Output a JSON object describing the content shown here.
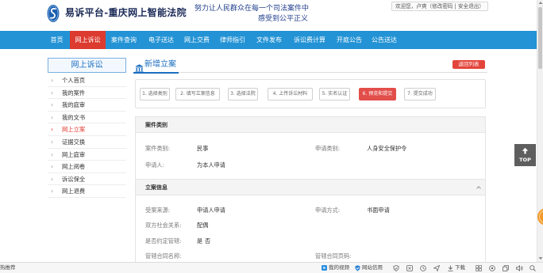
{
  "header": {
    "logo_icon": "court-emblem-icon",
    "site_title": "易诉平台-重庆网上智能法院",
    "slogan_line1": "努力让人民群众在每一个司法案件中",
    "slogan_line2": "感受到公平正义",
    "welcome": "欢迎您，卢爽（",
    "change_password": "修改密码",
    "separator": " | ",
    "logout": "安全退出",
    "welcome_end": "）"
  },
  "nav": {
    "items": [
      {
        "label": "首页",
        "active": false
      },
      {
        "label": "网上诉讼",
        "active": true
      },
      {
        "label": "案件查询",
        "active": false
      },
      {
        "label": "电子送达",
        "active": false
      },
      {
        "label": "网上交费",
        "active": false
      },
      {
        "label": "律师指引",
        "active": false
      },
      {
        "label": "文件发布",
        "active": false
      },
      {
        "label": "诉讼费计算",
        "active": false
      },
      {
        "label": "开庭公告",
        "active": false
      },
      {
        "label": "公告送达",
        "active": false
      }
    ]
  },
  "sidebar": {
    "title": "网上诉讼",
    "item_icon": "chevron-right-icon",
    "items": [
      {
        "label": "个人首页",
        "active": false
      },
      {
        "label": "我的案件",
        "active": false
      },
      {
        "label": "我的庭审",
        "active": false
      },
      {
        "label": "我的文书",
        "active": false
      },
      {
        "label": "网上立案",
        "active": true
      },
      {
        "label": "证据交换",
        "active": false
      },
      {
        "label": "网上庭审",
        "active": false
      },
      {
        "label": "网上阅卷",
        "active": false
      },
      {
        "label": "诉讼保全",
        "active": false
      },
      {
        "label": "网上退费",
        "active": false
      }
    ]
  },
  "main": {
    "title_icon": "courthouse-icon",
    "page_title": "新增立案",
    "back_button": "返回列表",
    "steps": [
      {
        "label": "1. 选择类别",
        "active": false
      },
      {
        "label": "2. 填写立案信息",
        "active": false
      },
      {
        "label": "3. 选择法院",
        "active": false
      },
      {
        "label": "4. 上传诉讼材料",
        "active": false
      },
      {
        "label": "5. 实名认证",
        "active": false
      },
      {
        "label": "6. 预览和提交",
        "active": true
      },
      {
        "label": "7. 提交成功",
        "active": false
      }
    ],
    "case_category": {
      "title": "案件类别",
      "rows": [
        {
          "label": "案件类别:",
          "value": "民事",
          "label2": "申请类别:",
          "value2": "人身安全保护令"
        },
        {
          "label": "申请人:",
          "value": "为本人申请"
        }
      ]
    },
    "filing_info": {
      "title": "立案信息",
      "collapse_icon": "chevron-up-icon",
      "rows": [
        {
          "label": "受案来源:",
          "value": "申请人申请",
          "label2": "申请方式:",
          "value2": "书面申请"
        },
        {
          "label": "双方社会关系:",
          "value": "配偶"
        },
        {
          "label": "是否约定管辖:",
          "options": [
            "是",
            "否"
          ]
        },
        {
          "label": "管辖合同名称:",
          "label2": "管辖合同页码:"
        }
      ]
    }
  },
  "floating": {
    "top_label": "TOP",
    "top_icon": "arrow-up-icon",
    "service_icon": "floating-service-icon"
  },
  "status_bar": {
    "left_text": "热推荐",
    "my_video": "我的视频",
    "site_credit": "网站信用",
    "download": "下载",
    "icons": [
      "video-icon",
      "credit-icon",
      "shield-check-icon",
      "screenshot-icon",
      "clock-icon",
      "send-icon",
      "download-icon",
      "grid-icon",
      "browser-icon",
      "window-icon",
      "speaker-icon",
      "search-icon"
    ]
  },
  "colors": {
    "nav_bg": "#2393d5",
    "active_red": "#dc3b2f",
    "step_active": "#e24e4a",
    "link_blue": "#1b6dbf",
    "title_navy": "#1b2a57",
    "slogan_blue": "#23408e"
  }
}
